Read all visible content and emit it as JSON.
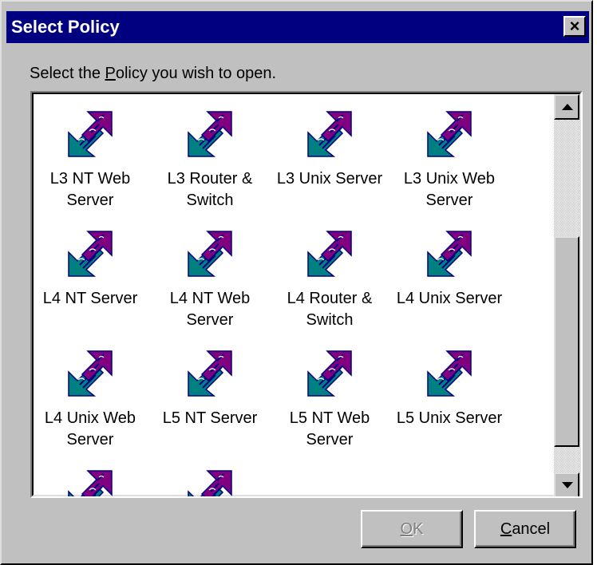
{
  "window": {
    "title": "Select Policy",
    "close_glyph": "×"
  },
  "prompt": {
    "before": "Select the ",
    "mnemonic": "P",
    "after": "olicy you wish to open."
  },
  "policies": [
    {
      "line1": "L3 NT Web",
      "line2": "Server"
    },
    {
      "line1": "L3 Router &",
      "line2": "Switch"
    },
    {
      "line1": "L3 Unix Server",
      "line2": ""
    },
    {
      "line1": "L3 Unix Web",
      "line2": "Server"
    },
    {
      "line1": "L4 NT Server",
      "line2": ""
    },
    {
      "line1": "L4 NT Web",
      "line2": "Server"
    },
    {
      "line1": "L4 Router &",
      "line2": "Switch"
    },
    {
      "line1": "L4 Unix Server",
      "line2": ""
    },
    {
      "line1": "L4 Unix Web",
      "line2": "Server"
    },
    {
      "line1": "L5 NT Server",
      "line2": ""
    },
    {
      "line1": "L5 NT Web",
      "line2": "Server"
    },
    {
      "line1": "L5 Unix Server",
      "line2": ""
    },
    {
      "line1": "",
      "line2": ""
    },
    {
      "line1": "",
      "line2": ""
    }
  ],
  "buttons": {
    "ok": {
      "mnemonic": "O",
      "rest": "K",
      "enabled": false
    },
    "cancel": {
      "mnemonic": "C",
      "rest": "ancel",
      "enabled": true
    }
  },
  "icon": {
    "name": "policy-icon",
    "colors": {
      "teal": "#008080",
      "purple": "#800080",
      "navy": "#000080"
    }
  },
  "colors": {
    "titlebar": "#000080",
    "face": "#c0c0c0"
  }
}
